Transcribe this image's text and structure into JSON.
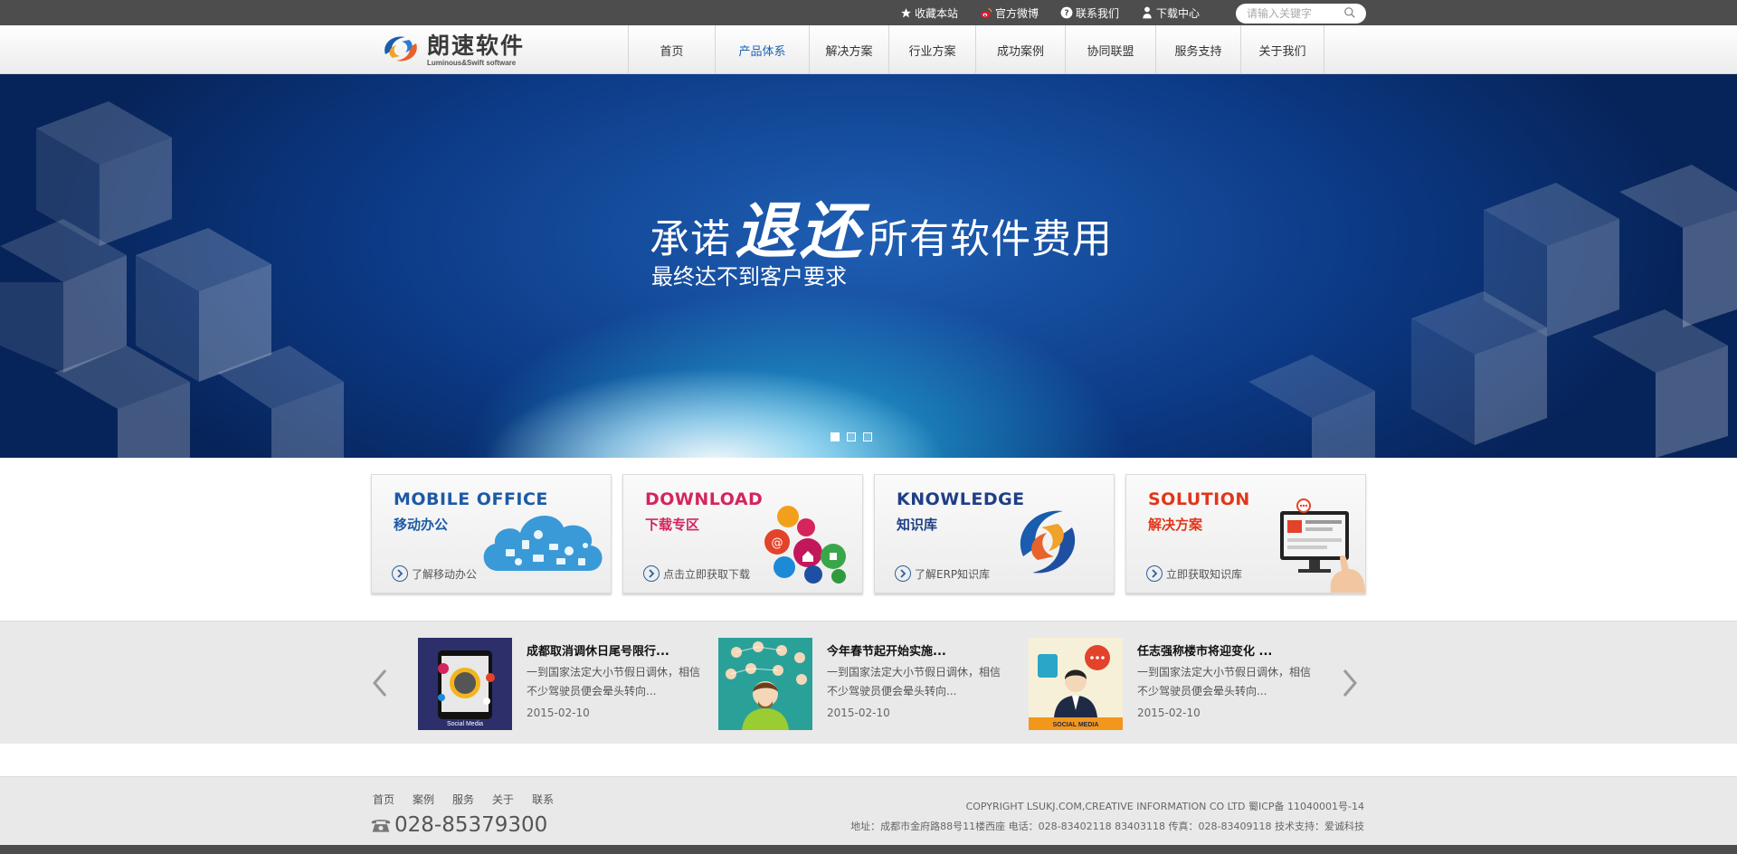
{
  "topbar": {
    "links": [
      {
        "label": "收藏本站",
        "icon": "star-icon"
      },
      {
        "label": "官方微博",
        "icon": "weibo-icon"
      },
      {
        "label": "联系我们",
        "icon": "question-icon"
      },
      {
        "label": "下载中心",
        "icon": "download-icon"
      }
    ],
    "search_placeholder": "请输入关键字"
  },
  "header": {
    "logo_cn": "朗速软件",
    "logo_en": "Luminous&Swift software",
    "nav": [
      {
        "label": "首页",
        "active": false
      },
      {
        "label": "产品体系",
        "active": true
      },
      {
        "label": "解决方案",
        "active": false
      },
      {
        "label": "行业方案",
        "active": false
      },
      {
        "label": "成功案例",
        "active": false
      },
      {
        "label": "协同联盟",
        "active": false
      },
      {
        "label": "服务支持",
        "active": false
      },
      {
        "label": "关于我们",
        "active": false
      }
    ]
  },
  "banner": {
    "title_a": "承诺",
    "title_b": "退还",
    "title_c": "所有软件费用",
    "subtitle": "最终达不到客户要求",
    "slides": 3,
    "active_slide": 1
  },
  "cards": [
    {
      "en": "MOBILE OFFICE",
      "cn": "移动办公",
      "link": "了解移动办公",
      "en_color": "#1d5aa6",
      "cn_color": "#1d5aa6"
    },
    {
      "en": "DOWNLOAD",
      "cn": "下载专区",
      "link": "点击立即获取下载",
      "en_color": "#d4255c",
      "cn_color": "#d4255c"
    },
    {
      "en": "KNOWLEDGE",
      "cn": "知识库",
      "link": "了解ERP知识库",
      "en_color": "#1f3f86",
      "cn_color": "#1f3f86"
    },
    {
      "en": "SOLUTION",
      "cn": "解决方案",
      "link": "立即获取知识库",
      "en_color": "#e0361b",
      "cn_color": "#e0361b"
    }
  ],
  "news": [
    {
      "title": "成都取消调休日尾号限行...",
      "desc": "一到国家法定大小节假日调休，相信不少驾驶员便会晕头转向...",
      "date": "2015-02-10"
    },
    {
      "title": "今年春节起开始实施...",
      "desc": "一到国家法定大小节假日调休，相信不少驾驶员便会晕头转向...",
      "date": "2015-02-10"
    },
    {
      "title": "任志强称楼市将迎变化 ...",
      "desc": "一到国家法定大小节假日调休，相信不少驾驶员便会晕头转向...",
      "date": "2015-02-10"
    }
  ],
  "news_thumb_labels": [
    "Social Media",
    "SOCIAL MEDIA"
  ],
  "footer": {
    "nav": [
      "首页",
      "案例",
      "服务",
      "关于",
      "联系"
    ],
    "phone": "028-85379300",
    "copyright": "COPYRIGHT LSUKJ.COM,CREATIVE INFORMATION CO LTD 蜀ICP备 11040001号-14",
    "address": "地址：成都市金府路88号11楼西座   电话：028-83402118 83403118 传真：028-83409118 技术支持：爱诚科技"
  }
}
